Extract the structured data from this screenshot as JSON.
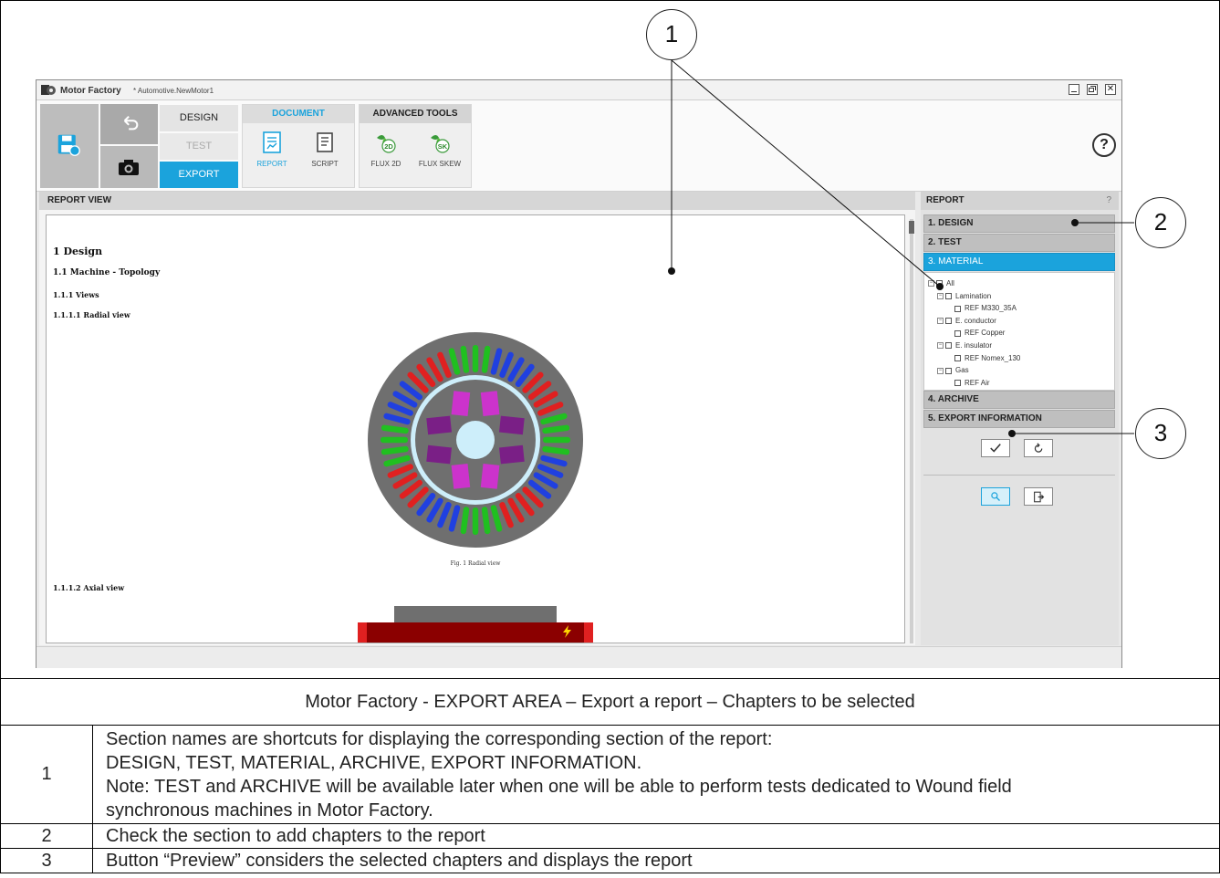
{
  "window": {
    "app_name": "Motor Factory",
    "project": "* Automotive.NewMotor1"
  },
  "ribbon": {
    "modes": [
      "DESIGN",
      "TEST",
      "EXPORT"
    ],
    "active_mode": "EXPORT",
    "document_group": {
      "title": "DOCUMENT",
      "tools": [
        {
          "label": "REPORT",
          "icon": "report-icon",
          "active": true
        },
        {
          "label": "SCRIPT",
          "icon": "script-icon",
          "active": false
        }
      ]
    },
    "advanced_group": {
      "title": "ADVANCED TOOLS",
      "tools": [
        {
          "label": "FLUX 2D",
          "icon": "flux-2d-icon",
          "badge": "2D"
        },
        {
          "label": "FLUX SKEW",
          "icon": "flux-skew-icon",
          "badge": "SK"
        }
      ]
    },
    "help_icon": "?"
  },
  "report_view": {
    "title": "REPORT VIEW",
    "headings": [
      "1 Design",
      "1.1 Machine - Topology",
      "1.1.1 Views",
      "1.1.1.1 Radial view"
    ],
    "figure_caption": "Fig. 1 Radial view",
    "axial_heading": "1.1.1.2 Axial view"
  },
  "side_panel": {
    "title": "REPORT",
    "help": "?",
    "sections": [
      {
        "label": "1. DESIGN",
        "active": false
      },
      {
        "label": "2. TEST",
        "active": false
      },
      {
        "label": "3. MATERIAL",
        "active": true
      },
      {
        "label": "4. ARCHIVE",
        "active": false
      },
      {
        "label": "5. EXPORT INFORMATION",
        "active": false
      }
    ],
    "material_tree": [
      {
        "label": "All",
        "level": 0,
        "expandable": true
      },
      {
        "label": "Lamination",
        "level": 1,
        "expandable": true
      },
      {
        "label": "REF M330_35A",
        "level": 2,
        "expandable": false
      },
      {
        "label": "E. conductor",
        "level": 1,
        "expandable": true
      },
      {
        "label": "REF Copper",
        "level": 2,
        "expandable": false
      },
      {
        "label": "E. insulator",
        "level": 1,
        "expandable": true
      },
      {
        "label": "REF Nomex_130",
        "level": 2,
        "expandable": false
      },
      {
        "label": "Gas",
        "level": 1,
        "expandable": true
      },
      {
        "label": "REF Air",
        "level": 2,
        "expandable": false
      }
    ]
  },
  "callouts": [
    "1",
    "2",
    "3"
  ],
  "colors": {
    "accent": "#1ba3dc",
    "stator": "#6f6f6f",
    "rotor_bore": "#cdeefa",
    "magnet": "#cc33cc",
    "coil_red": "#e02020",
    "coil_green": "#20c020",
    "coil_blue": "#2040e0"
  },
  "caption": "Motor Factory - EXPORT AREA – Export a report – Chapters to be selected",
  "legend": [
    {
      "num": "1",
      "lines": [
        "Section names are shortcuts for displaying the corresponding section of the report:",
        "DESIGN, TEST, MATERIAL, ARCHIVE, EXPORT INFORMATION.",
        "Note: TEST and ARCHIVE will be available later when one will be able to perform tests dedicated to Wound field",
        "synchronous machines in Motor Factory."
      ]
    },
    {
      "num": "2",
      "lines": [
        "Check the section to add chapters to the report"
      ]
    },
    {
      "num": "3",
      "lines": [
        "Button “Preview” considers the selected chapters and displays the report"
      ]
    }
  ]
}
